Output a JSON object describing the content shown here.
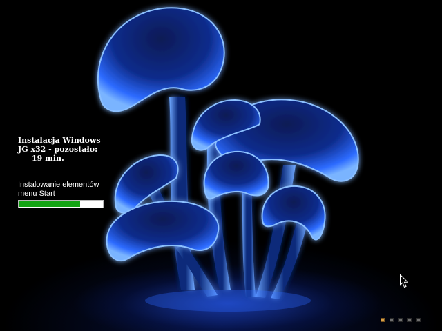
{
  "setup": {
    "title_line1": "Instalacja Windows",
    "title_line2": "JG x32 - pozostało:",
    "time_remaining": "19 min.",
    "step_line1": "Instalowanie elementów",
    "step_line2": "menu Start",
    "progress_fraction": 0.73,
    "progress_color": "#13a313"
  },
  "wallpaper": {
    "subject": "glowing blue mushrooms",
    "glow_color": "#3c8cff"
  },
  "pager": {
    "count": 5,
    "active_index": 0,
    "active_color": "#d8a048",
    "inactive_color": "#707070"
  },
  "icons": {
    "cursor": "arrow-cursor-icon"
  }
}
